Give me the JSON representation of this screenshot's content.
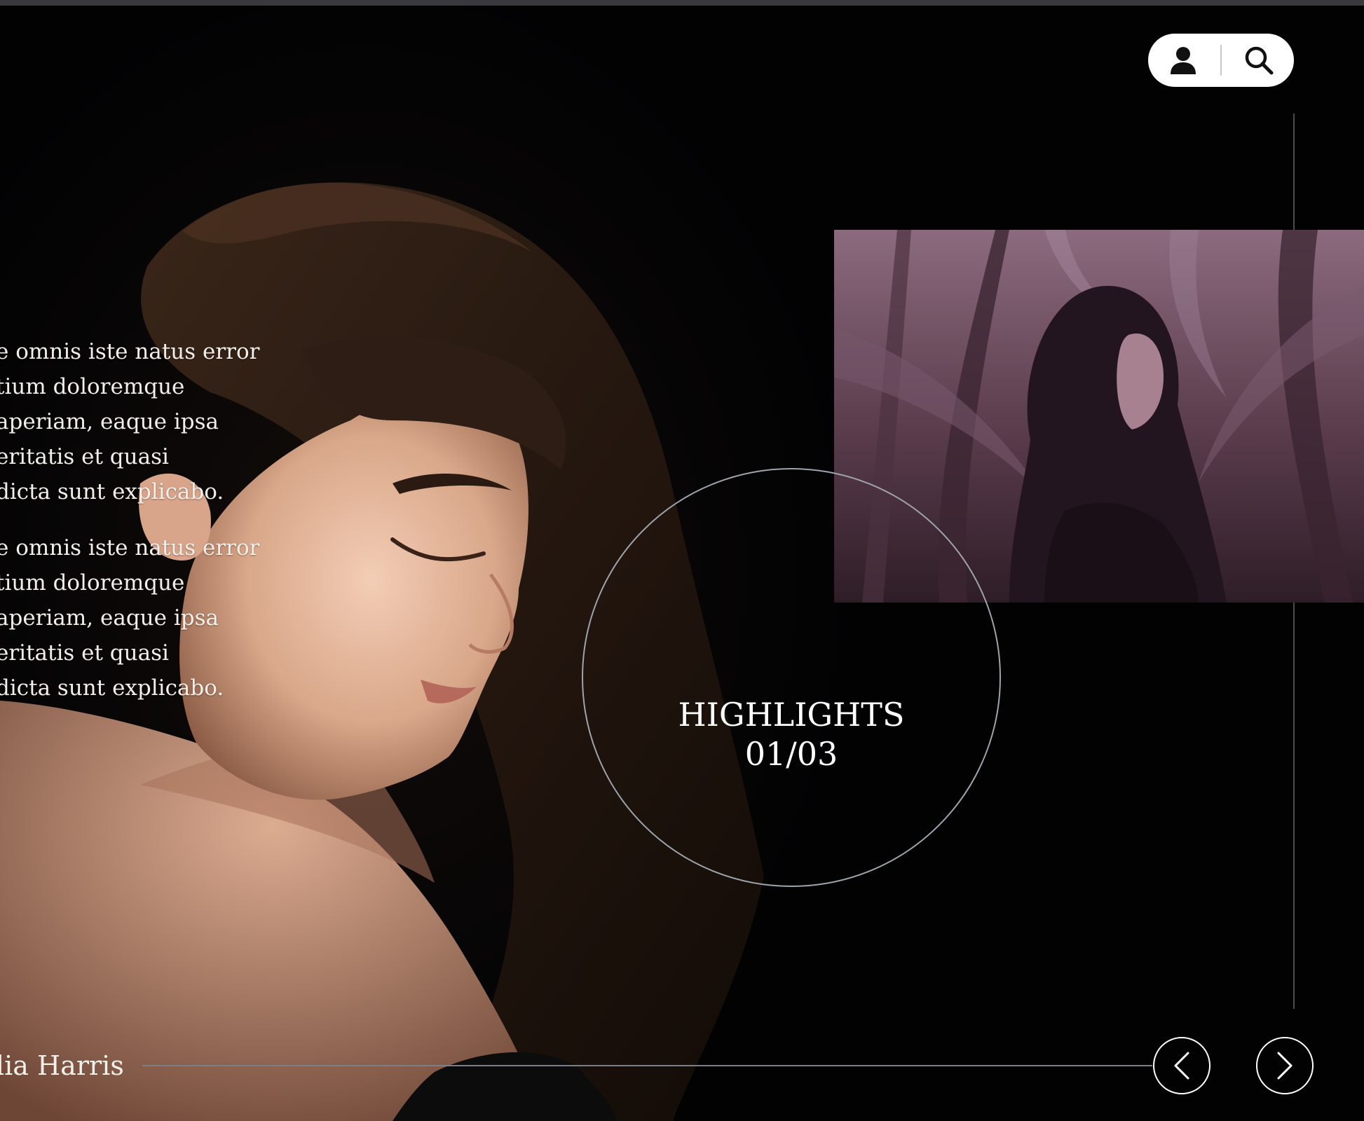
{
  "header": {
    "user_button": {
      "icon": "user-icon"
    },
    "search_button": {
      "icon": "search-icon"
    }
  },
  "intro": {
    "paragraph_1": [
      "e omnis iste natus error",
      "tium doloremque",
      " aperiam, eaque ipsa",
      "eritatis et quasi",
      "dicta sunt explicabo."
    ],
    "paragraph_2": [
      "e omnis iste natus error",
      "tium doloremque",
      " aperiam, eaque ipsa",
      "eritatis et quasi",
      "dicta sunt explicabo."
    ]
  },
  "highlights": {
    "label": "HIGHLIGHTS",
    "counter": "01/03"
  },
  "author": "lia Harris",
  "navigation": {
    "prev_icon": "chevron-left-icon",
    "next_icon": "chevron-right-icon"
  },
  "colors": {
    "background": "#030304",
    "text": "#ffffff",
    "photo_tint": "#6b4a5c",
    "circle_stroke": "#9ea4ad"
  }
}
